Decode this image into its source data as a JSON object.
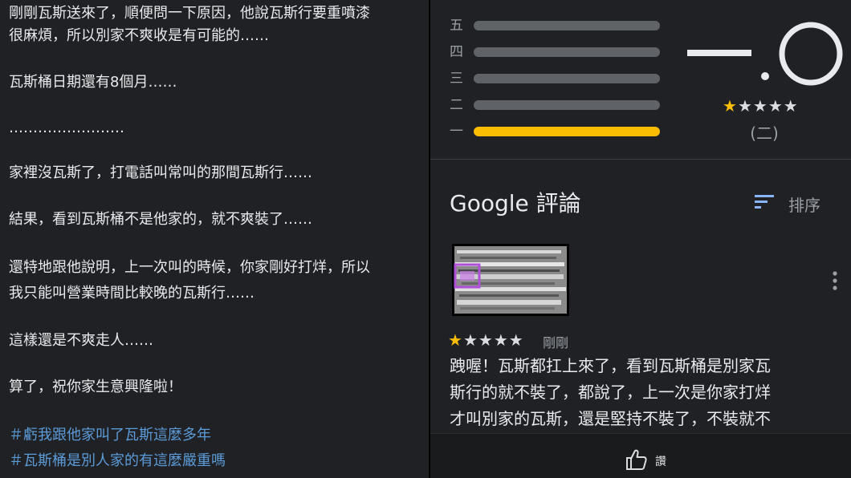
{
  "post": {
    "lines": [
      "剛剛瓦斯送來了，順便問一下原因，他說瓦斯行要重噴漆",
      "很麻煩，所以別家不爽收是有可能的……",
      "瓦斯桶日期還有8個月……",
      "……………………",
      "家裡沒瓦斯了，打電話叫常叫的那間瓦斯行……",
      "結果，看到瓦斯桶不是他家的，就不爽裝了……",
      "還特地跟他說明，上一次叫的時候，你家剛好打烊，所以",
      "我只能叫營業時間比較晚的瓦斯行……",
      "這樣還是不爽走人……",
      "算了，祝你家生意興隆啦！"
    ],
    "hashtags": [
      "＃虧我跟他家叫了瓦斯這麼多年",
      "＃瓦斯桶是別人家的有這麼嚴重嗎"
    ]
  },
  "rating_summary": {
    "bars": [
      {
        "label": "五",
        "fill_fraction": 0.0
      },
      {
        "label": "四",
        "fill_fraction": 0.0
      },
      {
        "label": "三",
        "fill_fraction": 0.0
      },
      {
        "label": "二",
        "fill_fraction": 0.0
      },
      {
        "label": "一",
        "fill_fraction": 1.0
      }
    ],
    "score_stars": 1,
    "review_count": "(二)"
  },
  "reviews_section": {
    "title": "Google 評論",
    "sort_label": "排序",
    "sort_icon": "sort-icon"
  },
  "review": {
    "stars": 1,
    "time": "剛剛",
    "lines": [
      "跩喔！瓦斯都扛上來了，看到瓦斯桶是別家瓦",
      "斯行的就不裝了，都說了，上一次是你家打烊",
      "才叫別家的瓦斯，還是堅持不裝了，不裝就不"
    ],
    "more_icon": "more-vert-icon"
  },
  "footer": {
    "like_label": "讚",
    "like_icon": "thumbs-up-icon"
  },
  "colors": {
    "panel_bg": "#202124",
    "text": "#e8eaed",
    "muted": "#9aa0a6",
    "star": "#fbbc04",
    "hashtag": "#5b9bd8",
    "sort_icon": "#8ab4f8"
  }
}
